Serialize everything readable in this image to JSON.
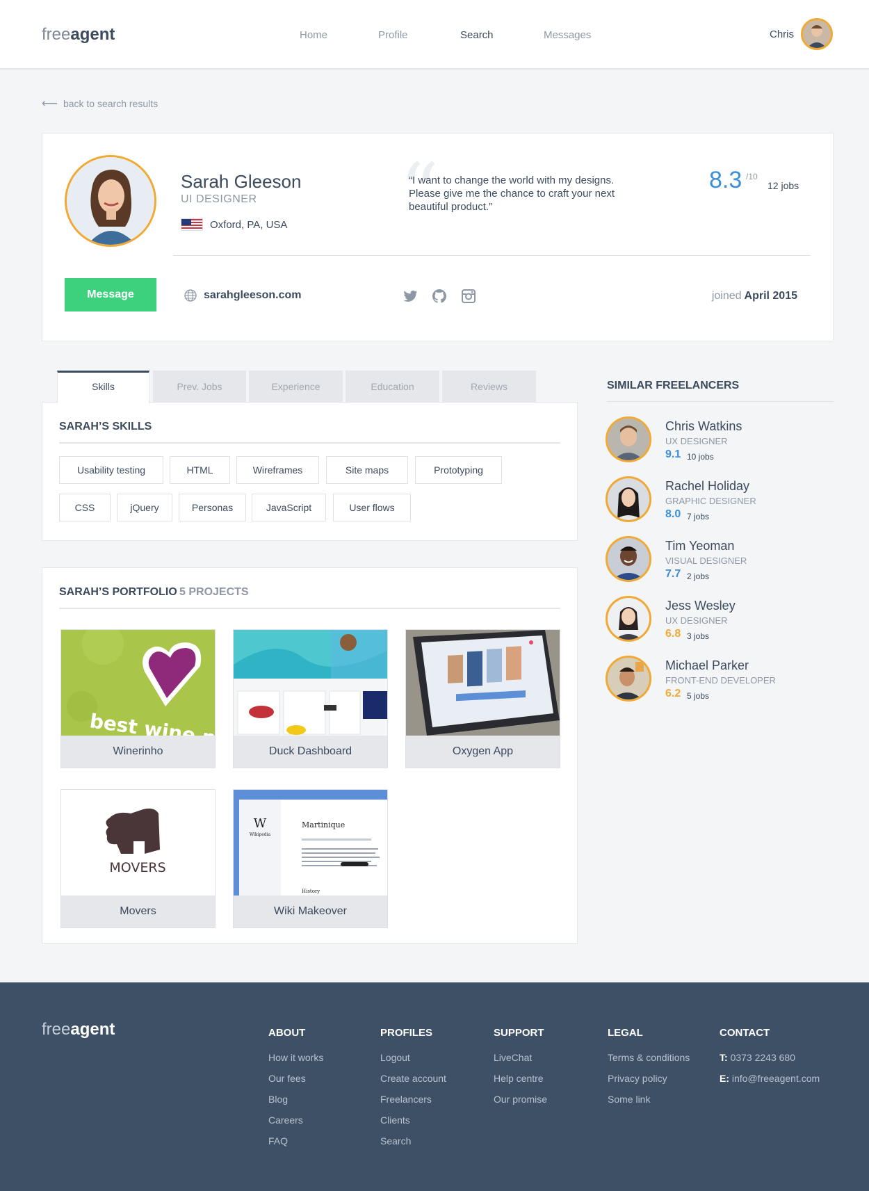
{
  "header": {
    "logo_light": "free",
    "logo_bold": "agent",
    "nav": [
      "Home",
      "Profile",
      "Search",
      "Messages"
    ],
    "user_name": "Chris"
  },
  "back_link": "back to search results",
  "profile": {
    "name": "Sarah Gleeson",
    "role": "UI DESIGNER",
    "location": "Oxford, PA, USA",
    "quote": "“I want to change the world with my designs. Please give me the chance to craft your next beautiful product.”",
    "rating": "8.3",
    "rating_of": "/10",
    "jobs": "12 jobs",
    "message_button": "Message",
    "website": "sarahgleeson.com",
    "joined_label": "joined",
    "joined_date": "April 2015"
  },
  "tabs": [
    "Skills",
    "Prev. Jobs",
    "Experience",
    "Education",
    "Reviews"
  ],
  "skills": {
    "title": "SARAH’S SKILLS",
    "items": [
      "Usability testing",
      "HTML",
      "Wireframes",
      "Site maps",
      "Prototyping",
      "CSS",
      "jQuery",
      "Personas",
      "JavaScript",
      "User flows"
    ]
  },
  "portfolio": {
    "title": "SARAH’S PORTFOLIO",
    "count": "5 PROJECTS",
    "projects": [
      "Winerinho",
      "Duck Dashboard",
      "Oxygen App",
      "Movers",
      "Wiki Makeover"
    ],
    "thumb_text": {
      "wine": "best wine near",
      "movers": "MOVERS",
      "wiki_w": "W",
      "wiki_name": "Wikipedia",
      "wiki_heading": "Martinique",
      "wiki_sub": "History"
    }
  },
  "similar": {
    "title": "SIMILAR FREELANCERS",
    "people": [
      {
        "name": "Chris Watkins",
        "role": "UX DESIGNER",
        "score": "9.1",
        "jobs": "10 jobs",
        "score_color": "#3d8ed8"
      },
      {
        "name": "Rachel Holiday",
        "role": "GRAPHIC DESIGNER",
        "score": "8.0",
        "jobs": "7 jobs",
        "score_color": "#3d8ed8"
      },
      {
        "name": "Tim Yeoman",
        "role": "VISUAL DESIGNER",
        "score": "7.7",
        "jobs": "2 jobs",
        "score_color": "#3d8ed8"
      },
      {
        "name": "Jess Wesley",
        "role": "UX DESIGNER",
        "score": "6.8",
        "jobs": "3 jobs",
        "score_color": "#f0a933"
      },
      {
        "name": "Michael Parker",
        "role": "FRONT-END DEVELOPER",
        "score": "6.2",
        "jobs": "5 jobs",
        "score_color": "#f0a933"
      }
    ]
  },
  "footer": {
    "logo_light": "free",
    "logo_bold": "agent",
    "about": {
      "title": "ABOUT",
      "links": [
        "How it works",
        "Our fees",
        "Blog",
        "Careers",
        "FAQ"
      ]
    },
    "profiles": {
      "title": "PROFILES",
      "links": [
        "Logout",
        "Create account",
        "Freelancers",
        "Clients",
        "Search"
      ]
    },
    "support": {
      "title": "SUPPORT",
      "links": [
        "LiveChat",
        "Help centre",
        "Our promise"
      ]
    },
    "legal": {
      "title": "LEGAL",
      "links": [
        "Terms & conditions",
        "Privacy policy",
        "Some link"
      ]
    },
    "contact": {
      "title": "CONTACT",
      "phone_label": "T:",
      "phone": "0373 2243 680",
      "email_label": "E:",
      "email": "info@freeagent.com"
    }
  },
  "colors": {
    "accent_blue": "#3d8ed8",
    "accent_orange": "#f0a933",
    "green": "#3dd17e",
    "footer": "#3e5066"
  }
}
